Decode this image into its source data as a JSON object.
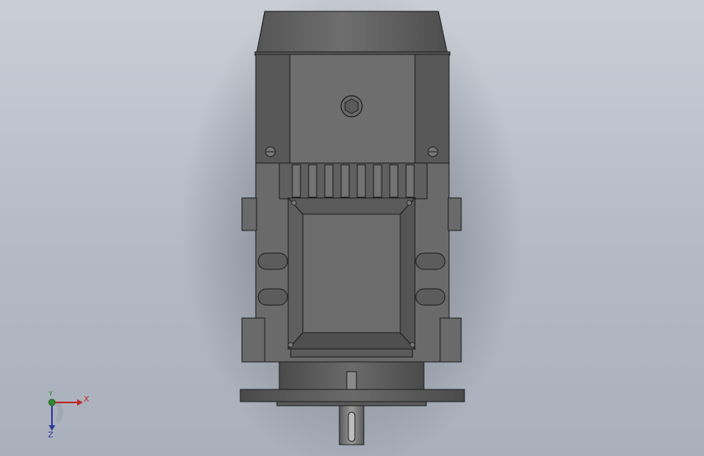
{
  "viewport": {
    "background_top": "#c9ced6",
    "background_bottom": "#a9b0bc",
    "model_fill": "#6b6b6b",
    "model_edge": "#1e1e1e"
  },
  "triad": {
    "x_label": "X",
    "y_label": "Y",
    "z_label": "Z",
    "x_color": "#c0282a",
    "y_color": "#2e8b2e",
    "z_color": "#2b3c9b"
  }
}
